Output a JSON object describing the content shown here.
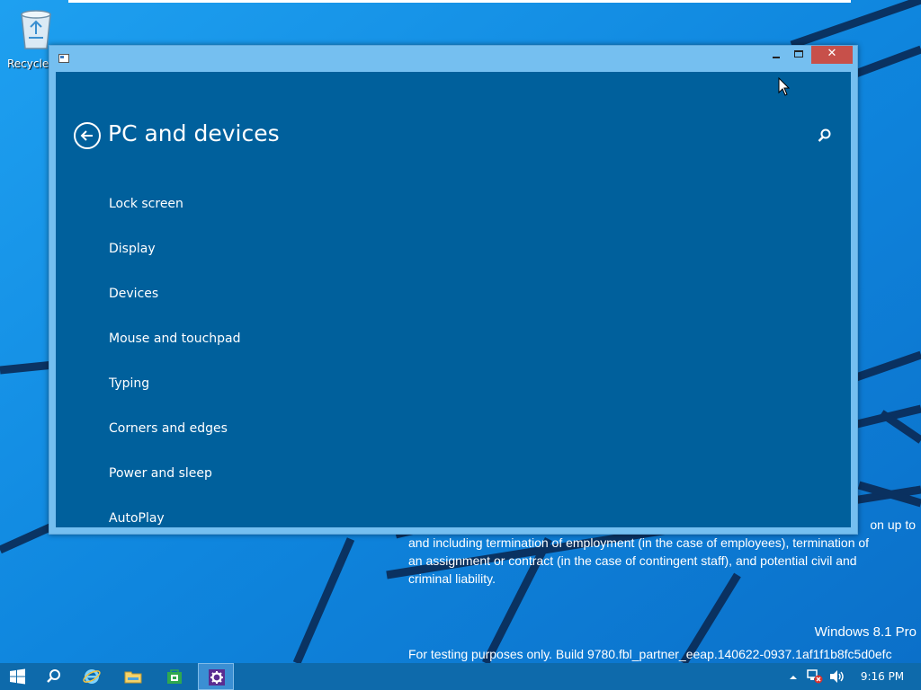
{
  "desktop": {
    "recycle_bin_label": "Recycle Bin",
    "legal_lines": [
      "on up to",
      "and including termination of employment (in the case of employees), termination of",
      "an assignment or contract (in the case of contingent staff), and potential civil and",
      "criminal liability."
    ],
    "edition": "Windows 8.1 Pro",
    "build": "For testing purposes only. Build 9780.fbl_partner_eeap.140622-0937.1af1f1b8fc5d0efc"
  },
  "window": {
    "page_title": "PC and devices",
    "nav_items": [
      "Lock screen",
      "Display",
      "Devices",
      "Mouse and touchpad",
      "Typing",
      "Corners and edges",
      "Power and sleep",
      "AutoPlay"
    ],
    "close_glyph": "✕"
  },
  "taskbar": {
    "icons": [
      "windows-start-icon",
      "search-icon",
      "internet-explorer-icon",
      "file-explorer-icon",
      "store-icon",
      "settings-icon"
    ],
    "clock": "9:16 PM"
  },
  "colors": {
    "desktop": "#1a8be0",
    "window_frame": "#75bff0",
    "client": "#00609c",
    "close_button": "#c7504a",
    "taskbar": "#0e6aab"
  }
}
